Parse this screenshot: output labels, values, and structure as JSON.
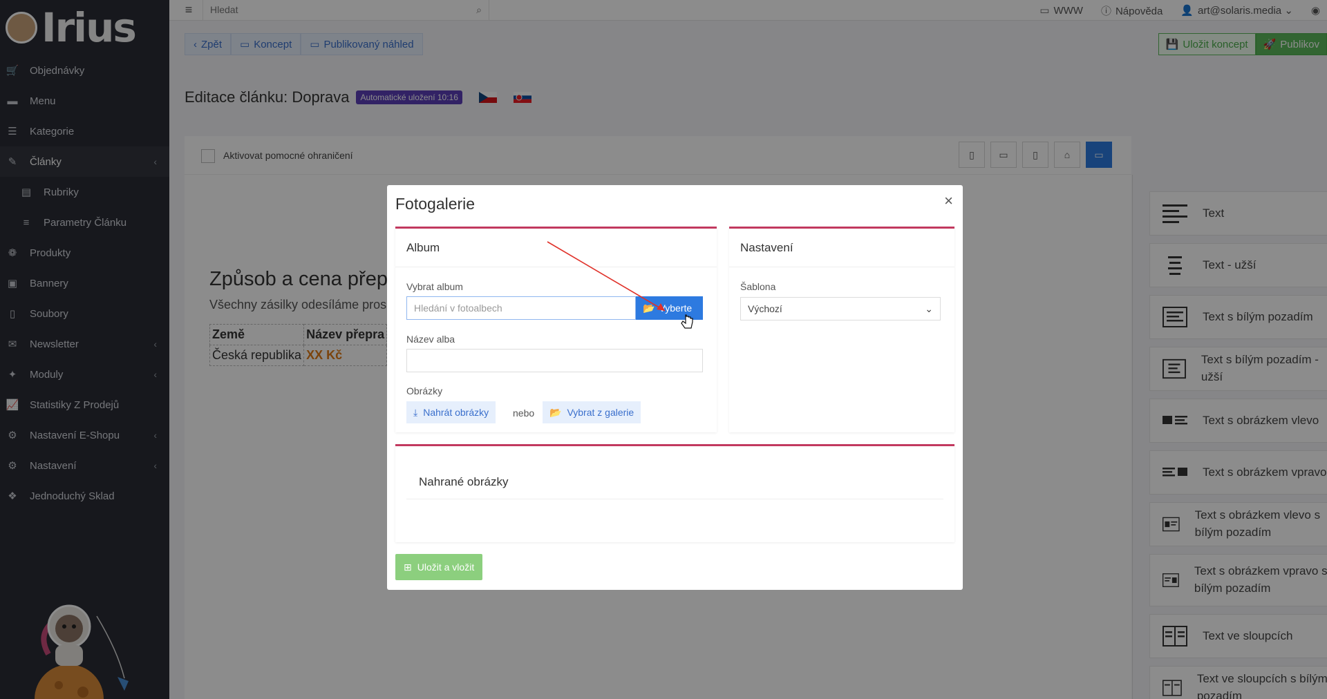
{
  "logo": {
    "text": "Irius"
  },
  "sidebar": {
    "items": [
      {
        "label": "Objednávky",
        "icon": "cart-icon"
      },
      {
        "label": "Menu",
        "icon": "folder-icon"
      },
      {
        "label": "Kategorie",
        "icon": "list-icon"
      },
      {
        "label": "Články",
        "icon": "pencil-icon",
        "active": true
      },
      {
        "label": "Rubriky",
        "icon": "newspaper-icon",
        "sub": true
      },
      {
        "label": "Parametry Článku",
        "icon": "sliders-icon",
        "sub": true
      },
      {
        "label": "Produkty",
        "icon": "box-icon"
      },
      {
        "label": "Bannery",
        "icon": "image-icon"
      },
      {
        "label": "Soubory",
        "icon": "file-icon"
      },
      {
        "label": "Newsletter",
        "icon": "envelope-icon"
      },
      {
        "label": "Moduly",
        "icon": "puzzle-icon"
      },
      {
        "label": "Statistiky Z Prodejů",
        "icon": "chart-icon"
      },
      {
        "label": "Nastavení E-Shopu",
        "icon": "cogs-icon"
      },
      {
        "label": "Nastavení",
        "icon": "cogs-icon"
      },
      {
        "label": "Jednoduchý Sklad",
        "icon": "boxes-icon"
      }
    ]
  },
  "topbar": {
    "search_placeholder": "Hledat",
    "www": "WWW",
    "help": "Nápověda",
    "user": "art@solaris.media"
  },
  "toolbar": {
    "back": "Zpět",
    "draft": "Koncept",
    "published_preview": "Publikovaný náhled",
    "save_draft": "Uložit koncept",
    "publish": "Publikov"
  },
  "page": {
    "heading_prefix": "Editace článku:",
    "heading_name": "Doprava",
    "autosave": "Automatické uložení 10:16"
  },
  "editor": {
    "helper_checkbox": "Aktivovat pomocné ohraničení",
    "content_title": "Způsob a cena přep",
    "content_lead": "Všechny zásilky odesíláme pros",
    "table_headers": [
      "Země",
      "Název přepra"
    ],
    "table_row": [
      "Česká republika",
      "XX Kč"
    ]
  },
  "blocks": [
    {
      "label": "Text"
    },
    {
      "label": "Text - užší"
    },
    {
      "label": "Text s bílým pozadím"
    },
    {
      "label": "Text s bílým pozadím - užší"
    },
    {
      "label": "Text s obrázkem vlevo"
    },
    {
      "label": "Text s obrázkem vpravo"
    },
    {
      "label": "Text s obrázkem vlevo s bílým pozadím"
    },
    {
      "label": "Text s obrázkem vpravo s bílým pozadím"
    },
    {
      "label": "Text ve sloupcích"
    },
    {
      "label": "Text ve sloupcích s bílým pozadím"
    }
  ],
  "modal": {
    "title": "Fotogalerie",
    "close": "×",
    "album": {
      "header": "Album",
      "select_label": "Vybrat album",
      "search_placeholder": "Hledání v fotoalbech",
      "select_button": "Vyberte",
      "name_label": "Název alba",
      "images_label": "Obrázky",
      "upload_button": "Nahrát obrázky",
      "or": "nebo",
      "gallery_button": "Vybrat z galerie"
    },
    "settings": {
      "header": "Nastavení",
      "template_label": "Šablona",
      "template_value": "Výchozí"
    },
    "uploaded": {
      "header": "Nahrané obrázky"
    },
    "save_button": "Uložit a vložit"
  },
  "colors": {
    "sidebar_bg": "#2a2d36",
    "accent_blue": "#2d7ae0",
    "card_border": "#c2395f",
    "green": "#5cb85c",
    "autosave_badge": "#5b3fb8",
    "price": "#e07b16",
    "annotation_arrow": "#e0322a"
  }
}
